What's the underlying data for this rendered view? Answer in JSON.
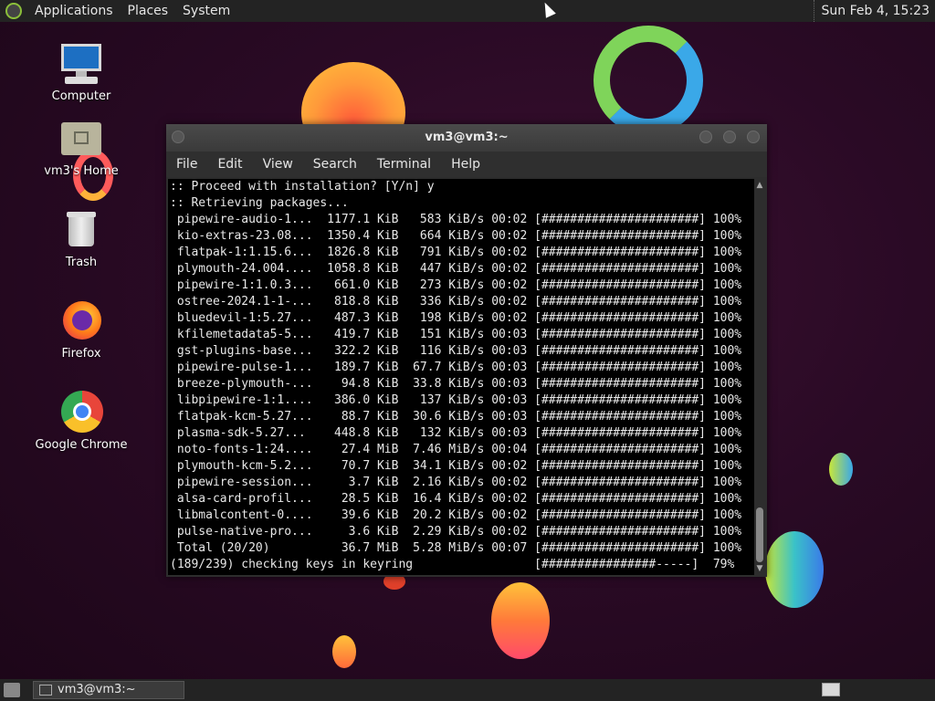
{
  "top_panel": {
    "menus": [
      "Applications",
      "Places",
      "System"
    ],
    "clock": "Sun Feb  4, 15:23"
  },
  "desktop_icons": [
    "Computer",
    "vm3's Home",
    "Trash",
    "Firefox",
    "Google Chrome"
  ],
  "terminal": {
    "title": "vm3@vm3:~",
    "menu": [
      "File",
      "Edit",
      "View",
      "Search",
      "Terminal",
      "Help"
    ],
    "lines": [
      ":: Proceed with installation? [Y/n] y",
      ":: Retrieving packages...",
      " pipewire-audio-1...  1177.1 KiB   583 KiB/s 00:02 [######################] 100%",
      " kio-extras-23.08...  1350.4 KiB   664 KiB/s 00:02 [######################] 100%",
      " flatpak-1:1.15.6...  1826.8 KiB   791 KiB/s 00:02 [######################] 100%",
      " plymouth-24.004....  1058.8 KiB   447 KiB/s 00:02 [######################] 100%",
      " pipewire-1:1.0.3...   661.0 KiB   273 KiB/s 00:02 [######################] 100%",
      " ostree-2024.1-1-...   818.8 KiB   336 KiB/s 00:02 [######################] 100%",
      " bluedevil-1:5.27...   487.3 KiB   198 KiB/s 00:02 [######################] 100%",
      " kfilemetadata5-5...   419.7 KiB   151 KiB/s 00:03 [######################] 100%",
      " gst-plugins-base...   322.2 KiB   116 KiB/s 00:03 [######################] 100%",
      " pipewire-pulse-1...   189.7 KiB  67.7 KiB/s 00:03 [######################] 100%",
      " breeze-plymouth-...    94.8 KiB  33.8 KiB/s 00:03 [######################] 100%",
      " libpipewire-1:1....   386.0 KiB   137 KiB/s 00:03 [######################] 100%",
      " flatpak-kcm-5.27...    88.7 KiB  30.6 KiB/s 00:03 [######################] 100%",
      " plasma-sdk-5.27...    448.8 KiB   132 KiB/s 00:03 [######################] 100%",
      " noto-fonts-1:24....    27.4 MiB  7.46 MiB/s 00:04 [######################] 100%",
      " plymouth-kcm-5.2...    70.7 KiB  34.1 KiB/s 00:02 [######################] 100%",
      " pipewire-session...     3.7 KiB  2.16 KiB/s 00:02 [######################] 100%",
      " alsa-card-profil...    28.5 KiB  16.4 KiB/s 00:02 [######################] 100%",
      " libmalcontent-0....    39.6 KiB  20.2 KiB/s 00:02 [######################] 100%",
      " pulse-native-pro...     3.6 KiB  2.29 KiB/s 00:02 [######################] 100%",
      " Total (20/20)          36.7 MiB  5.28 MiB/s 00:07 [######################] 100%",
      "(189/239) checking keys in keyring                 [################-----]  79%"
    ]
  },
  "taskbar": {
    "task_label": "vm3@vm3:~"
  }
}
